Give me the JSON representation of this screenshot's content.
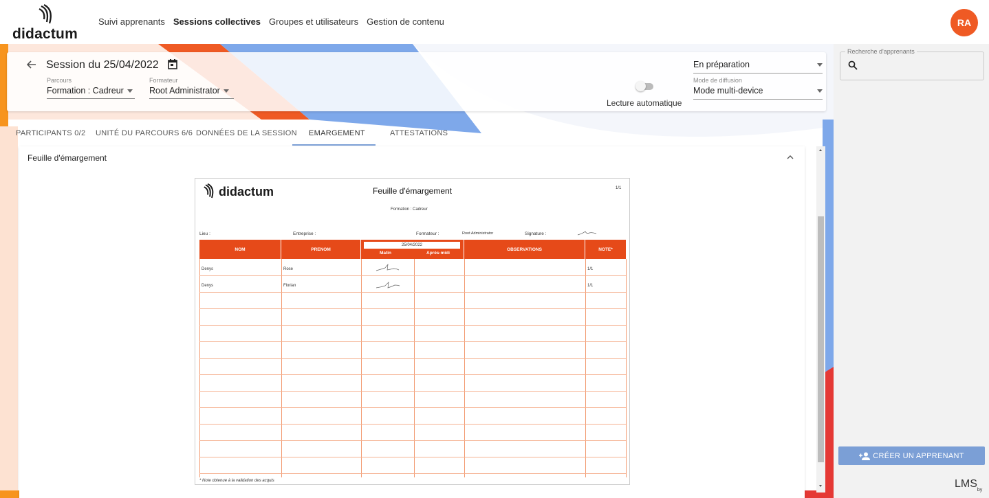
{
  "brand": {
    "name": "didactum"
  },
  "nav": {
    "items": [
      {
        "label": "Suivi apprenants"
      },
      {
        "label": "Sessions collectives",
        "active": true
      },
      {
        "label": "Groupes et utilisateurs"
      },
      {
        "label": "Gestion de contenu"
      }
    ]
  },
  "user": {
    "initials": "RA"
  },
  "colors": {
    "accent": "#ef5a24",
    "blue": "#7b9fd6",
    "table_header": "#e64a19"
  },
  "session": {
    "title": "Session du 25/04/2022",
    "parcours": {
      "label": "Parcours",
      "value": "Formation : Cadreur"
    },
    "formateur": {
      "label": "Formateur",
      "value": "Root Administrator"
    },
    "autoplay_label": "Lecture automatique",
    "autoplay_on": false,
    "status": {
      "value": "En préparation"
    },
    "diffusion": {
      "label": "Mode de diffusion",
      "value": "Mode multi-device"
    }
  },
  "tabs": [
    {
      "label": "PARTICIPANTS 0/2"
    },
    {
      "label": "UNITÉ DU PARCOURS 6/6"
    },
    {
      "label": "DONNÉES DE LA SESSION"
    },
    {
      "label": "EMARGEMENT",
      "active": true
    },
    {
      "label": "ATTESTATIONS"
    }
  ],
  "panel": {
    "title": "Feuille d'émargement"
  },
  "sheet": {
    "brand": "didactum",
    "title": "Feuille d'émargement",
    "page": "1/1",
    "formation": "Formation : Cadreur",
    "lieu_label": "Lieu :",
    "entreprise_label": "Entreprise :",
    "formateur_label": "Formateur :",
    "formateur_value": "Root Administrator",
    "signature_label": "Signature :",
    "headers": {
      "nom": "NOM",
      "prenom": "PRENOM",
      "date": "25/04/2022",
      "matin": "Matin",
      "apres_midi": "Après-midi",
      "observations": "OBSERVATIONS",
      "note": "NOTE*"
    },
    "rows": [
      {
        "nom": "Denys",
        "prenom": "Rose",
        "note": "1/1"
      },
      {
        "nom": "Denys",
        "prenom": "Florian",
        "note": "1/1"
      }
    ],
    "footnote": "* Note obtenue à la validation des acquis"
  },
  "right_panel": {
    "search_legend": "Recherche d'apprenants",
    "create_button": "CRÉER UN APPRENANT"
  },
  "footer": {
    "lms": "LMS",
    "by": "by"
  }
}
